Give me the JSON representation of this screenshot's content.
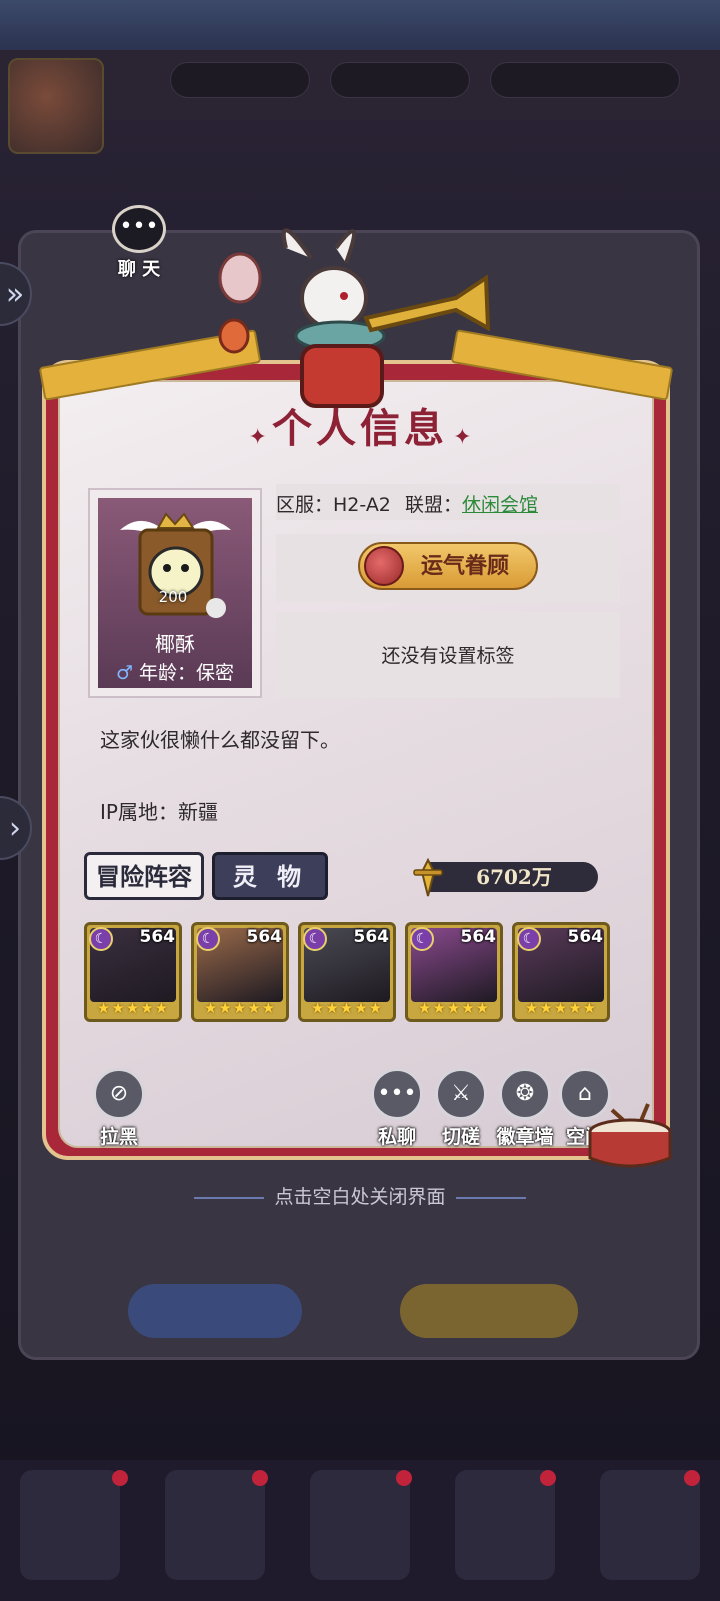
{
  "chat_button": {
    "label": "聊 天"
  },
  "modal": {
    "title": "个人信息",
    "profile": {
      "avatar_level": "200",
      "name": "椰酥",
      "age_line": "年龄：保密"
    },
    "server_label": "区服：H2-A2",
    "alliance_label": "联盟：",
    "alliance_name": "休闲会馆",
    "badge": "运气眷顾",
    "tag_placeholder": "还没有设置标签",
    "bio": "这家伙很懒什么都没留下。",
    "ip_location": "IP属地：新疆",
    "tabs": {
      "adventure_lineup": "冒险阵容",
      "spirit": "灵 物"
    },
    "power": "6702万",
    "heroes": [
      {
        "level": "564",
        "stars": 5,
        "color": "#3a2f3e"
      },
      {
        "level": "564",
        "stars": 5,
        "color": "#9a6a4a"
      },
      {
        "level": "564",
        "stars": 5,
        "color": "#4a4a52"
      },
      {
        "level": "564",
        "stars": 5,
        "color": "#8a4a8e"
      },
      {
        "level": "564",
        "stars": 5,
        "color": "#5a3a5a"
      }
    ],
    "actions": {
      "block": "拉黑",
      "private_chat": "私聊",
      "spar": "切磋",
      "badge_wall": "徽章墙",
      "space": "空间"
    }
  },
  "close_hint": "点击空白处关闭界面",
  "colors": {
    "modal_frame": "#a8283a",
    "title": "#8d2236",
    "alliance_link": "#2c8a3a",
    "star": "#ffd23a"
  }
}
